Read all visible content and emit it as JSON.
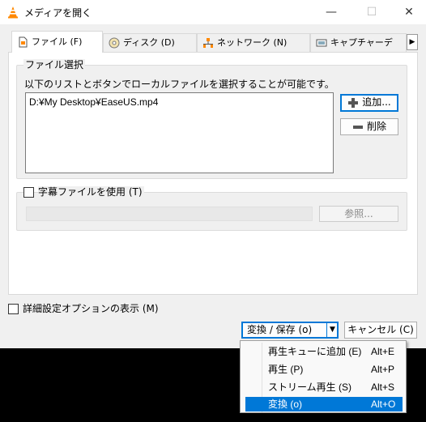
{
  "window": {
    "title": "メディアを開く",
    "minimize": "—",
    "maximize": "☐",
    "close": "✕"
  },
  "tabs": [
    {
      "label": "ファイル (F)",
      "icon": "file-icon"
    },
    {
      "label": "ディスク (D)",
      "icon": "disc-icon"
    },
    {
      "label": "ネットワーク (N)",
      "icon": "network-icon"
    },
    {
      "label": "キャプチャーデ",
      "icon": "capture-icon"
    }
  ],
  "tab_scroll": "▶",
  "file_selection": {
    "group_title": "ファイル選択",
    "description": "以下のリストとボタンでローカルファイルを選択することが可能です。",
    "files": [
      "D:¥My Desktop¥EaseUS.mp4"
    ],
    "add_button": "追加...",
    "delete_button": "削除"
  },
  "subtitle": {
    "checkbox_label": "字幕ファイルを使用 (T)",
    "browse_button": "参照..."
  },
  "advanced": {
    "checkbox_label": "詳細設定オプションの表示 (M)"
  },
  "footer": {
    "convert_button": "変換 / 保存 (o)",
    "cancel_button": "キャンセル (C)"
  },
  "dropdown_menu": [
    {
      "label": "再生キューに追加 (E)",
      "shortcut": "Alt+E",
      "highlighted": false
    },
    {
      "label": "再生 (P)",
      "shortcut": "Alt+P",
      "highlighted": false
    },
    {
      "label": "ストリーム再生 (S)",
      "shortcut": "Alt+S",
      "highlighted": false
    },
    {
      "label": "変換 (o)",
      "shortcut": "Alt+O",
      "highlighted": true
    }
  ],
  "colors": {
    "accent": "#0078d7",
    "vlc_orange": "#ff8800"
  }
}
